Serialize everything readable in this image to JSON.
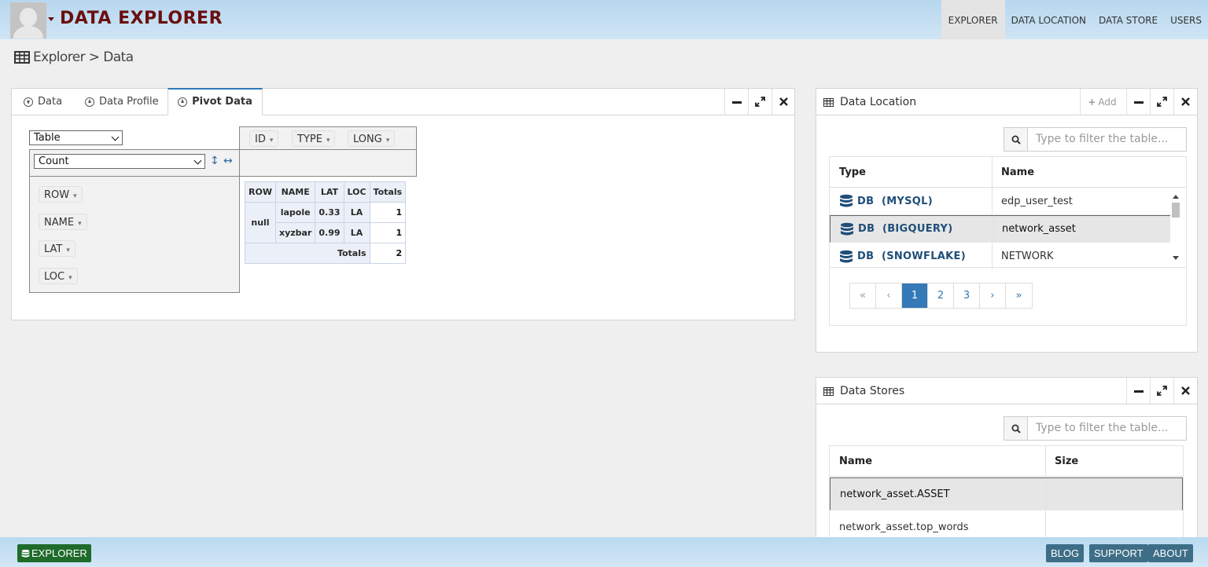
{
  "header": {
    "title": "DATA EXPLORER",
    "nav": [
      "EXPLORER",
      "DATA LOCATION",
      "DATA STORE",
      "USERS"
    ]
  },
  "breadcrumb": "Explorer > Data",
  "explorer_panel": {
    "tabs": [
      "Data",
      "Data Profile",
      "Pivot Data"
    ],
    "active_tab": "Pivot Data",
    "renderer_select": "Table",
    "aggregator_select": "Count",
    "column_chips": [
      "ID",
      "TYPE",
      "LONG"
    ],
    "row_chips": [
      "ROW",
      "NAME",
      "LAT",
      "LOC"
    ],
    "pivot_table": {
      "headers": [
        "ROW",
        "NAME",
        "LAT",
        "LOC",
        "Totals"
      ],
      "group_label": "null",
      "rows": [
        {
          "name": "lapole",
          "lat": "0.33",
          "loc": "LA",
          "total": "1"
        },
        {
          "name": "xyzbar",
          "lat": "0.99",
          "loc": "LA",
          "total": "1"
        }
      ],
      "totals_label": "Totals",
      "grand_total": "2"
    }
  },
  "data_location_panel": {
    "title": "Data Location",
    "add_label": "Add",
    "search_placeholder": "Type to filter the table...",
    "columns": [
      "Type",
      "Name"
    ],
    "rows": [
      {
        "type": "DB  (MYSQL)",
        "name": "edp_user_test"
      },
      {
        "type": "DB  (BIGQUERY)",
        "name": "network_asset"
      },
      {
        "type": "DB  (SNOWFLAKE)",
        "name": "NETWORK"
      }
    ],
    "pagination": [
      "«",
      "‹",
      "1",
      "2",
      "3",
      "›",
      "»"
    ],
    "current_page": "1"
  },
  "data_stores_panel": {
    "title": "Data Stores",
    "search_placeholder": "Type to filter the table...",
    "columns": [
      "Name",
      "Size"
    ],
    "rows": [
      {
        "name": "network_asset.ASSET",
        "size": ""
      },
      {
        "name": "network_asset.top_words",
        "size": ""
      }
    ]
  },
  "footer": {
    "explorer_label": "EXPLORER",
    "buttons": [
      "BLOG",
      "SUPPORT",
      "ABOUT"
    ]
  },
  "colors": {
    "brand": "#6a0f0f",
    "link": "#337ab7",
    "db_type": "#1f4e79",
    "footer_green": "#1f6b2a",
    "footer_steel": "#3e6e87"
  }
}
